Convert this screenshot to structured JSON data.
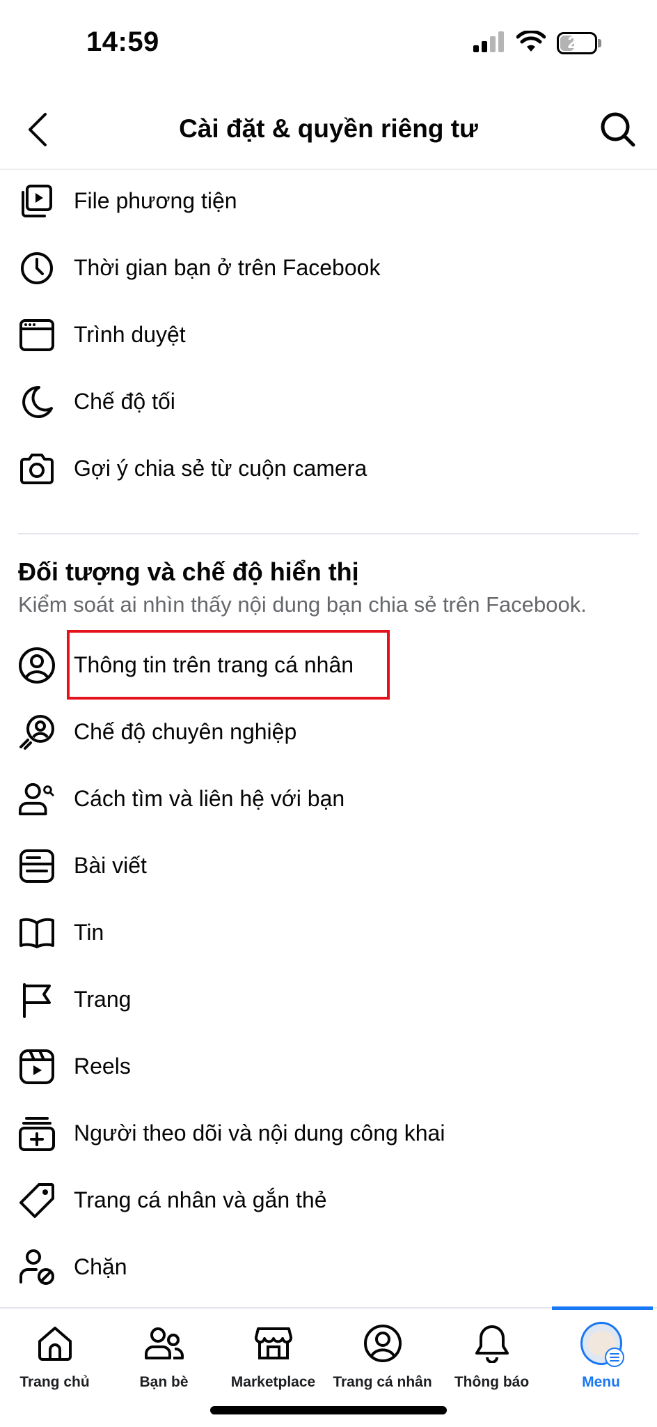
{
  "status_bar": {
    "time": "14:59",
    "battery": "21",
    "battery_level": 0.21,
    "icons": [
      "signal-icon",
      "wifi-icon",
      "battery-icon"
    ]
  },
  "header": {
    "title": "Cài đặt & quyền riêng tư",
    "back_icon": "chevron-left-icon",
    "search_icon": "search-icon"
  },
  "preferences": {
    "items": [
      {
        "label": "File phương tiện",
        "icon": "media-icon"
      },
      {
        "label": "Thời gian bạn ở trên Facebook",
        "icon": "clock-icon"
      },
      {
        "label": "Trình duyệt",
        "icon": "browser-icon"
      },
      {
        "label": "Chế độ tối",
        "icon": "moon-icon"
      },
      {
        "label": "Gợi ý chia sẻ từ cuộn camera",
        "icon": "camera-icon"
      }
    ]
  },
  "audience": {
    "title": "Đối tượng và chế độ hiển thị",
    "subtitle": "Kiểm soát ai nhìn thấy nội dung bạn chia sẻ trên Facebook.",
    "items": [
      {
        "label": "Thông tin trên trang cá nhân",
        "icon": "profile-circle-icon",
        "highlighted": true
      },
      {
        "label": "Chế độ chuyên nghiệp",
        "icon": "professional-icon"
      },
      {
        "label": "Cách tìm và liên hệ với bạn",
        "icon": "people-search-icon"
      },
      {
        "label": "Bài viết",
        "icon": "post-icon"
      },
      {
        "label": "Tin",
        "icon": "book-icon"
      },
      {
        "label": "Trang",
        "icon": "flag-icon"
      },
      {
        "label": "Reels",
        "icon": "reels-icon"
      },
      {
        "label": "Người theo dõi và nội dung công khai",
        "icon": "followers-icon"
      },
      {
        "label": "Trang cá nhân và gắn thẻ",
        "icon": "tag-icon"
      },
      {
        "label": "Chặn",
        "icon": "block-user-icon"
      }
    ]
  },
  "tab_bar": {
    "tabs": [
      {
        "label": "Trang chủ",
        "icon": "home-icon"
      },
      {
        "label": "Bạn bè",
        "icon": "friends-icon"
      },
      {
        "label": "Marketplace",
        "icon": "marketplace-icon"
      },
      {
        "label": "Trang cá nhân",
        "icon": "profile-icon"
      },
      {
        "label": "Thông báo",
        "icon": "bell-icon"
      },
      {
        "label": "Menu",
        "icon": "avatar-menu-icon",
        "active": true
      }
    ],
    "accent_color": "#1877f2"
  },
  "colors": {
    "highlight": "#e4131b",
    "subtitle": "#65676b",
    "text": "#050505"
  }
}
